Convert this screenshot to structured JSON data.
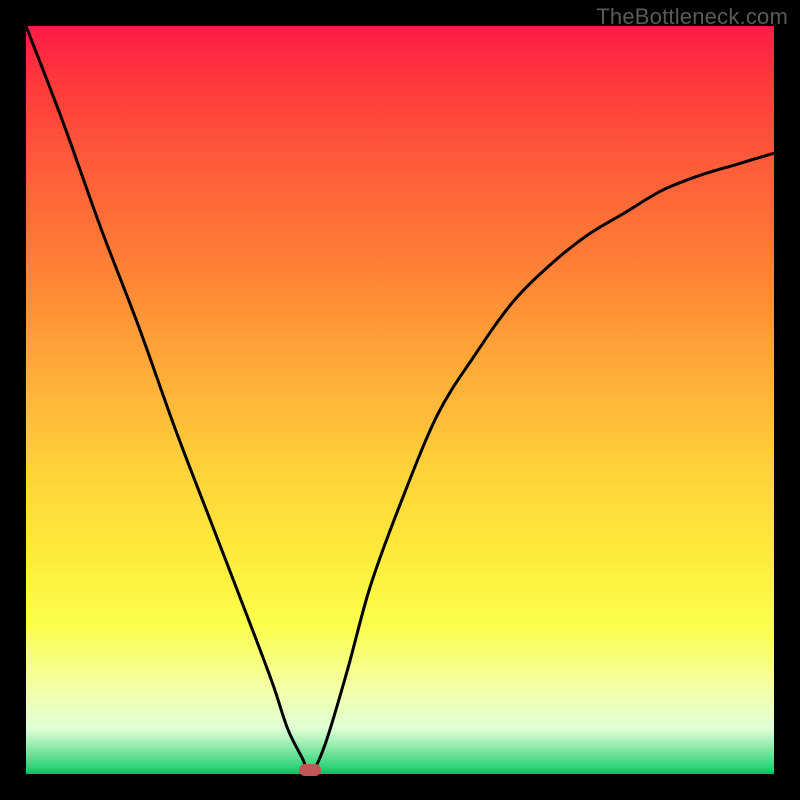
{
  "watermark": "TheBottleneck.com",
  "chart_data": {
    "type": "line",
    "title": "",
    "xlabel": "",
    "ylabel": "",
    "xlim": [
      0,
      100
    ],
    "ylim": [
      0,
      100
    ],
    "grid": false,
    "series": [
      {
        "name": "bottleneck-curve",
        "x": [
          0,
          5,
          10,
          15,
          20,
          25,
          30,
          33,
          35,
          37,
          38,
          40,
          43,
          46,
          50,
          55,
          60,
          65,
          70,
          75,
          80,
          85,
          90,
          95,
          100
        ],
        "y": [
          100,
          87,
          73,
          60,
          46,
          33,
          20,
          12,
          6,
          2,
          0,
          4,
          14,
          25,
          36,
          48,
          56,
          63,
          68,
          72,
          75,
          78,
          80,
          81.5,
          83
        ]
      }
    ],
    "minimum_marker": {
      "x": 38,
      "y": 0
    },
    "gradient_stops": [
      {
        "pos": 0,
        "color": "#ff1a46"
      },
      {
        "pos": 8,
        "color": "#ff3b3b"
      },
      {
        "pos": 18,
        "color": "#ff5a3a"
      },
      {
        "pos": 30,
        "color": "#ff7a36"
      },
      {
        "pos": 44,
        "color": "#ffa538"
      },
      {
        "pos": 60,
        "color": "#ffd43a"
      },
      {
        "pos": 70,
        "color": "#ffe93a"
      },
      {
        "pos": 80,
        "color": "#fbff4a"
      },
      {
        "pos": 88,
        "color": "#f5ffa0"
      },
      {
        "pos": 94,
        "color": "#dfffd6"
      },
      {
        "pos": 99,
        "color": "#33d47a"
      },
      {
        "pos": 100,
        "color": "#00c060"
      }
    ]
  }
}
